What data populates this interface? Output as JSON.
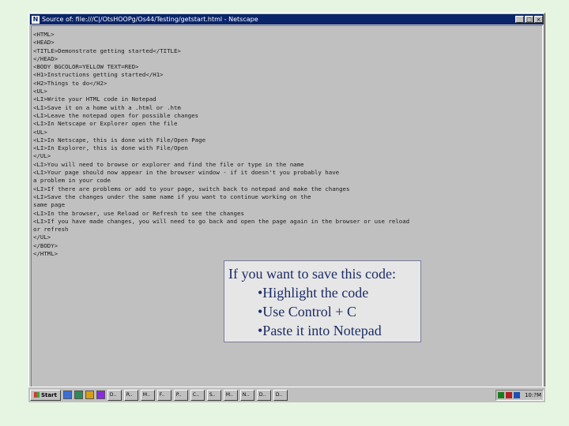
{
  "window": {
    "title": "Source of: file:///C|/OtsHOOPg/Os44/Testing/getstart.html - Netscape",
    "app_icon": "N",
    "controls": [
      "_",
      "□",
      "×"
    ]
  },
  "source_lines": [
    "<HTML>",
    "<HEAD>",
    "<TITLE>Demonstrate getting started</TITLE>",
    "</HEAD>",
    "<BODY BGCOLOR=YELLOW TEXT=RED>",
    "<H1>Instructions getting started</H1>",
    "<H2>Things to do</H2>",
    "<UL>",
    "<LI>Write your HTML code in Notepad",
    "<LI>Save it on a home with a .html or .htm",
    "<LI>Leave the notepad open for possible changes",
    "<LI>In Netscape or Explorer open the file",
    "<UL>",
    "<LI>In Netscape, this is done with File/Open Page",
    "<LI>In Explorer, this is done with File/Open",
    "</UL>",
    "<LI>You will need to browse or explorer and find the file or type in the name",
    "<LI>Your page should now appear in the browser window - if it doesn't you probably have",
    "a problem in your code",
    "<LI>If there are problems or add to your page, switch back to notepad and make the changes",
    "<LI>Save the changes under the same name if you want to continue working on the",
    "same page",
    "<LI>In the browser, use Reload or Refresh to see the changes",
    "<LI>If you have made changes, you will need to go back and open the page again in the browser or use reload",
    "or refresh",
    "</UL>",
    "</BODY>",
    "</HTML>"
  ],
  "callout": {
    "heading": "If you want to save this code:",
    "items": [
      "•Highlight the code",
      "•Use Control + C",
      "•Paste it into Notepad"
    ]
  },
  "taskbar": {
    "start_label": "Start",
    "tasks": [
      "D..",
      "R..",
      "M..",
      "F..",
      "P..",
      "C..",
      "S..",
      "M..",
      "N..",
      "D..",
      "D.."
    ],
    "clock": "10:?M"
  },
  "colors": {
    "slide_background": "#e6f5e1",
    "window_gray": "#c0c0c0",
    "titlebar_blue": "#0a246a",
    "callout_text": "#1c2d66"
  },
  "icons": [
    "windows-flag-icon",
    "quick-launch-icon",
    "tray-icon"
  ]
}
